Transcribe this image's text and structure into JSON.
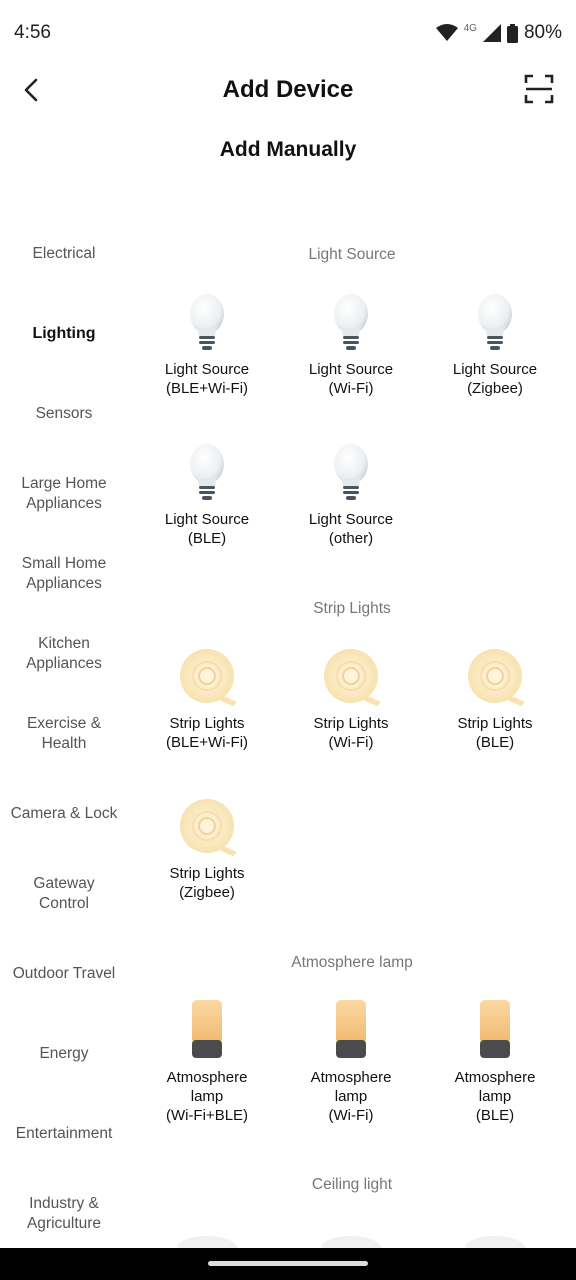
{
  "status": {
    "time": "4:56",
    "network": "4G",
    "battery": "80%"
  },
  "header": {
    "title": "Add Device"
  },
  "subtitle": "Add Manually",
  "sidebar": {
    "items": [
      {
        "label": "Electrical"
      },
      {
        "label": "Lighting",
        "active": true
      },
      {
        "label": "Sensors"
      },
      {
        "label": "Large Home\nAppliances"
      },
      {
        "label": "Small Home\nAppliances"
      },
      {
        "label": "Kitchen\nAppliances"
      },
      {
        "label": "Exercise &\nHealth"
      },
      {
        "label": "Camera & Lock"
      },
      {
        "label": "Gateway\nControl"
      },
      {
        "label": "Outdoor Travel"
      },
      {
        "label": "Energy"
      },
      {
        "label": "Entertainment"
      },
      {
        "label": "Industry &\nAgriculture"
      }
    ]
  },
  "sections": {
    "light_source": "Light Source",
    "strip_lights": "Strip Lights",
    "atmosphere": "Atmosphere lamp",
    "ceiling": "Ceiling light"
  },
  "devices": {
    "ls_ble_wifi": "Light Source\n(BLE+Wi-Fi)",
    "ls_wifi": "Light Source\n(Wi-Fi)",
    "ls_zigbee": "Light Source\n(Zigbee)",
    "ls_ble": "Light Source\n(BLE)",
    "ls_other": "Light Source\n(other)",
    "sl_ble_wifi": "Strip Lights\n(BLE+Wi-Fi)",
    "sl_wifi": "Strip Lights\n(Wi-Fi)",
    "sl_ble": "Strip Lights\n(BLE)",
    "sl_zigbee": "Strip Lights\n(Zigbee)",
    "al_wifi_ble": "Atmosphere\nlamp\n(Wi-Fi+BLE)",
    "al_wifi": "Atmosphere\nlamp\n(Wi-Fi)",
    "al_ble": "Atmosphere\nlamp\n(BLE)"
  },
  "icons": {
    "bulb": "light-bulb-icon",
    "strip": "strip-light-icon",
    "lamp": "atmosphere-lamp-icon",
    "ceiling": "ceiling-light-icon"
  }
}
